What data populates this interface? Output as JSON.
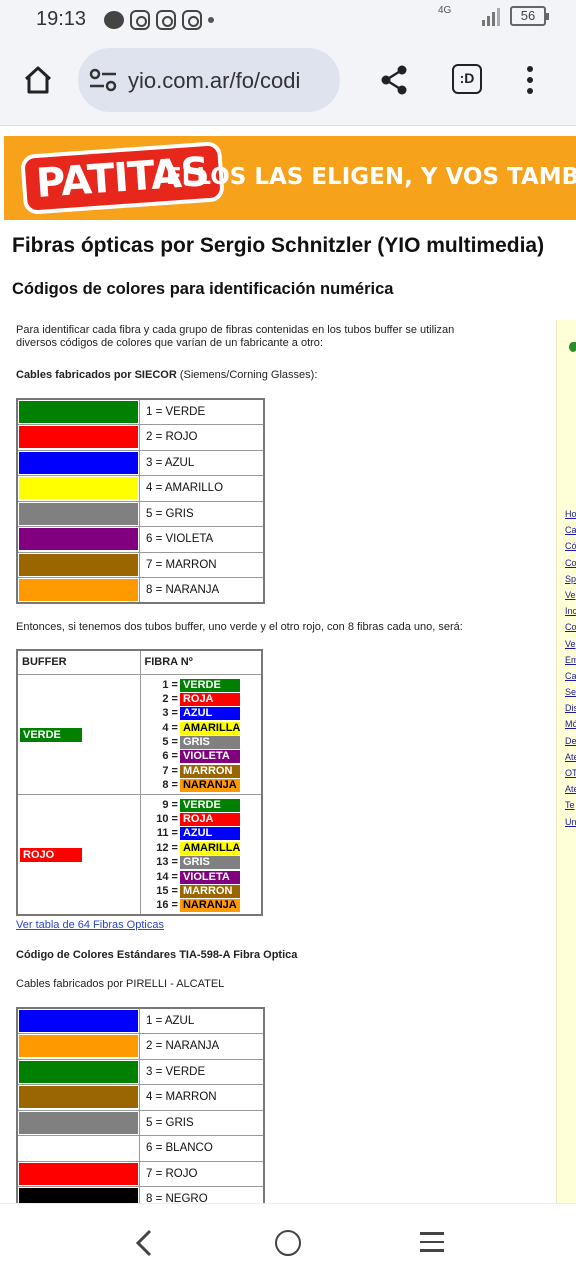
{
  "status": {
    "time": "19:13",
    "network": "4G",
    "battery": "56"
  },
  "browser": {
    "url": "yio.com.ar/fo/codi",
    "tabs_label": ":D"
  },
  "banner": {
    "logo": "PATITAS",
    "tagline": "ELLOS LAS ELIGEN, Y VOS TAMBIÉN"
  },
  "page": {
    "title": "Fibras ópticas por Sergio Schnitzler (YIO multimedia)",
    "subtitle": "Códigos de colores para identificación numérica",
    "intro_line1": "Para identificar cada fibra y cada grupo de fibras contenidas en los tubos buffer se utilizan",
    "intro_line2": "diversos códigos de colores que varían de un fabricante a otro:",
    "siecor_bold": "Cables fabricados por SIECOR",
    "siecor_rest": " (Siemens/Corning Glasses):",
    "example_text": "Entonces, si tenemos dos tubos buffer, uno verde y el otro rojo, con 8 fibras cada uno, será:",
    "link_64": "Ver tabla de 64 Fibras Opticas",
    "tia_title": "Código de Colores Estándares TIA-598-A Fibra Optica",
    "pirelli_text": "Cables fabricados por PIRELLI - ALCATEL"
  },
  "siecor_table": [
    {
      "label": "1 = VERDE",
      "color": "#008000"
    },
    {
      "label": "2 = ROJO",
      "color": "#ff0000"
    },
    {
      "label": "3 = AZUL",
      "color": "#0000ff"
    },
    {
      "label": "4 = AMARILLO",
      "color": "#ffff00"
    },
    {
      "label": "5 = GRIS",
      "color": "#808080"
    },
    {
      "label": "6 = VIOLETA",
      "color": "#800080"
    },
    {
      "label": "7 = MARRON",
      "color": "#996600"
    },
    {
      "label": "8 = NARANJA",
      "color": "#ff9900"
    }
  ],
  "buffer_table": {
    "header_buffer": "BUFFER",
    "header_fibra": "FIBRA Nº",
    "groups": [
      {
        "buffer": "VERDE",
        "buffer_color": "#008000",
        "fibers": [
          {
            "num": "1",
            "name": "VERDE",
            "color": "#008000",
            "text": "#ffffff"
          },
          {
            "num": "2",
            "name": "ROJA",
            "color": "#ff0000",
            "text": "#ffffff"
          },
          {
            "num": "3",
            "name": "AZUL",
            "color": "#0000ff",
            "text": "#ffffff"
          },
          {
            "num": "4",
            "name": "AMARILLA",
            "color": "#ffff00",
            "text": "#000000"
          },
          {
            "num": "5",
            "name": "GRIS",
            "color": "#808080",
            "text": "#ffffff"
          },
          {
            "num": "6",
            "name": "VIOLETA",
            "color": "#800080",
            "text": "#ffffff"
          },
          {
            "num": "7",
            "name": "MARRON",
            "color": "#996600",
            "text": "#ffffff"
          },
          {
            "num": "8",
            "name": "NARANJA",
            "color": "#ff9900",
            "text": "#000000"
          }
        ]
      },
      {
        "buffer": "ROJO",
        "buffer_color": "#ff0000",
        "fibers": [
          {
            "num": "9",
            "name": "VERDE",
            "color": "#008000",
            "text": "#ffffff"
          },
          {
            "num": "10",
            "name": "ROJA",
            "color": "#ff0000",
            "text": "#ffffff"
          },
          {
            "num": "11",
            "name": "AZUL",
            "color": "#0000ff",
            "text": "#ffffff"
          },
          {
            "num": "12",
            "name": "AMARILLA",
            "color": "#ffff00",
            "text": "#000000"
          },
          {
            "num": "13",
            "name": "GRIS",
            "color": "#808080",
            "text": "#ffffff"
          },
          {
            "num": "14",
            "name": "VIOLETA",
            "color": "#800080",
            "text": "#ffffff"
          },
          {
            "num": "15",
            "name": "MARRON",
            "color": "#996600",
            "text": "#ffffff"
          },
          {
            "num": "16",
            "name": "NARANJA",
            "color": "#ff9900",
            "text": "#000000"
          }
        ]
      }
    ]
  },
  "pirelli_table": [
    {
      "label": "1 = AZUL",
      "color": "#0000ff"
    },
    {
      "label": "2 = NARANJA",
      "color": "#ff9900"
    },
    {
      "label": "3 = VERDE",
      "color": "#008000"
    },
    {
      "label": "4 = MARRON",
      "color": "#996600"
    },
    {
      "label": "5 = GRIS",
      "color": "#808080"
    },
    {
      "label": "6 = BLANCO",
      "color": "#ffffff"
    },
    {
      "label": "7 = ROJO",
      "color": "#ff0000"
    },
    {
      "label": "8 = NEGRO",
      "color": "#000000"
    }
  ],
  "sidebar_links": [
    "Ho",
    "Ca",
    "Có",
    "Co",
    "Sp",
    "Ve",
    "Inc",
    "Co",
    "Ve",
    "Em",
    "Ca",
    "Se",
    "Dis",
    "Mó",
    "De",
    "Ate",
    "OT",
    "Ate",
    "Te",
    "Un"
  ]
}
